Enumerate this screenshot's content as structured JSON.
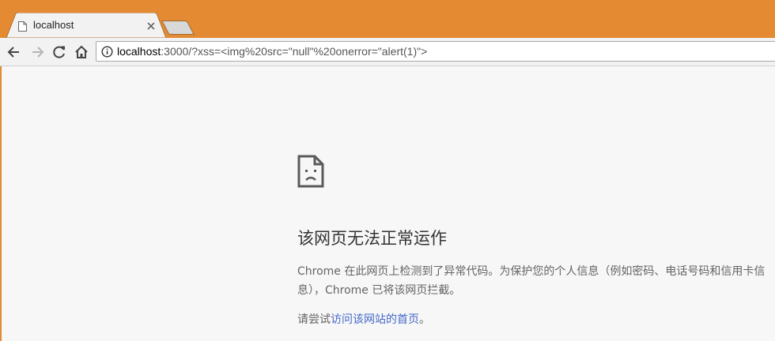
{
  "tab": {
    "title": "localhost",
    "favicon_icon": "page-icon",
    "close_icon": "close-icon"
  },
  "toolbar": {
    "back_icon": "arrow-left-icon",
    "forward_icon": "arrow-right-icon",
    "reload_icon": "reload-icon",
    "home_icon": "home-icon"
  },
  "omnibox": {
    "info_icon": "info-icon",
    "url_host": "localhost",
    "url_rest": ":3000/?xss=<img%20src=\"null\"%20onerror=\"alert(1)\">"
  },
  "error": {
    "icon": "sad-page-icon",
    "heading": "该网页无法正常运作",
    "description": "Chrome 在此网页上检测到了异常代码。为保护您的个人信息（例如密码、电话号码和信用卡信息），Chrome 已将该网页拦截。",
    "suggest_prefix": "请尝试",
    "suggest_link": "访问该网站的首页",
    "suggest_suffix": "。"
  },
  "colors": {
    "frame": "#e38a33",
    "page_background": "#f7f7f7",
    "link": "#4368c8"
  }
}
